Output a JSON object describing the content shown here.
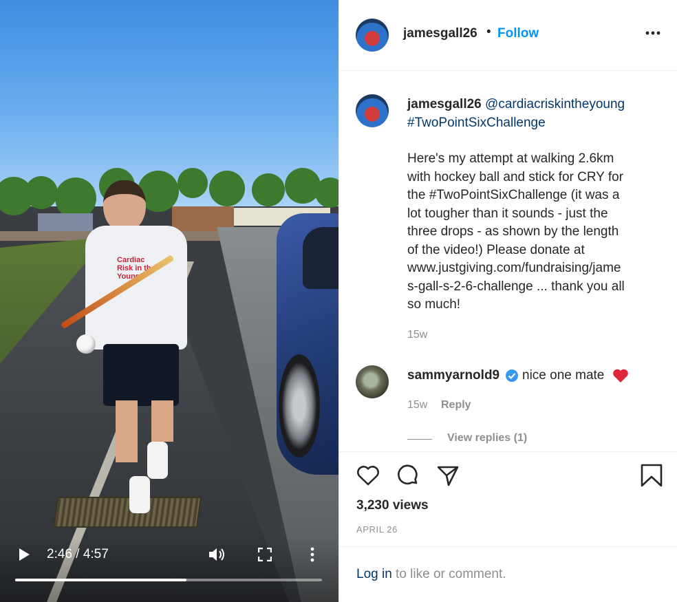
{
  "post": {
    "username": "jamesgall26",
    "follow_label": "Follow",
    "separator": "•"
  },
  "caption": {
    "username": "jamesgall26",
    "mention": "@cardiacriskintheyoung",
    "hashtag": "#TwoPointSixChallenge",
    "body": "Here's my attempt at walking 2.6km\nwith hockey ball and stick for CRY for\nthe #TwoPointSixChallenge (it was a\nlot tougher than it sounds - just the\nthree drops - as shown by the length\nof the video!) Please donate at\nwww.justgiving.com/fundraising/jame\ns-gall-s-2-6-challenge ... thank you all\nso much!",
    "time": "15w"
  },
  "comment": {
    "username": "sammyarnold9",
    "text": "nice one mate",
    "time": "15w",
    "reply_label": "Reply",
    "view_replies": "View replies (1)"
  },
  "stats": {
    "views": "3,230 views",
    "date": "APRIL 26"
  },
  "login": {
    "link": "Log in",
    "text": " to like or comment."
  },
  "video": {
    "time": "2:46 / 4:57",
    "progress_fraction": 0.558,
    "shirt_logo": "Cardiac\nRisk in the\nYoung"
  },
  "colors": {
    "accent": "#0095f6",
    "link": "#00376b",
    "muted": "#8e8e8e",
    "verified": "#3897f0",
    "heart": "#ed4956"
  },
  "icons": {
    "header_more": "more-horizontal-icon",
    "like": "heart-outline-icon",
    "comment": "comment-bubble-icon",
    "share": "paper-plane-icon",
    "save": "bookmark-icon",
    "play": "play-icon",
    "volume": "volume-icon",
    "fullscreen": "fullscreen-icon",
    "video_more": "more-vertical-icon",
    "verified": "verified-badge-icon",
    "emoji": "red-heart-emoji-icon"
  }
}
